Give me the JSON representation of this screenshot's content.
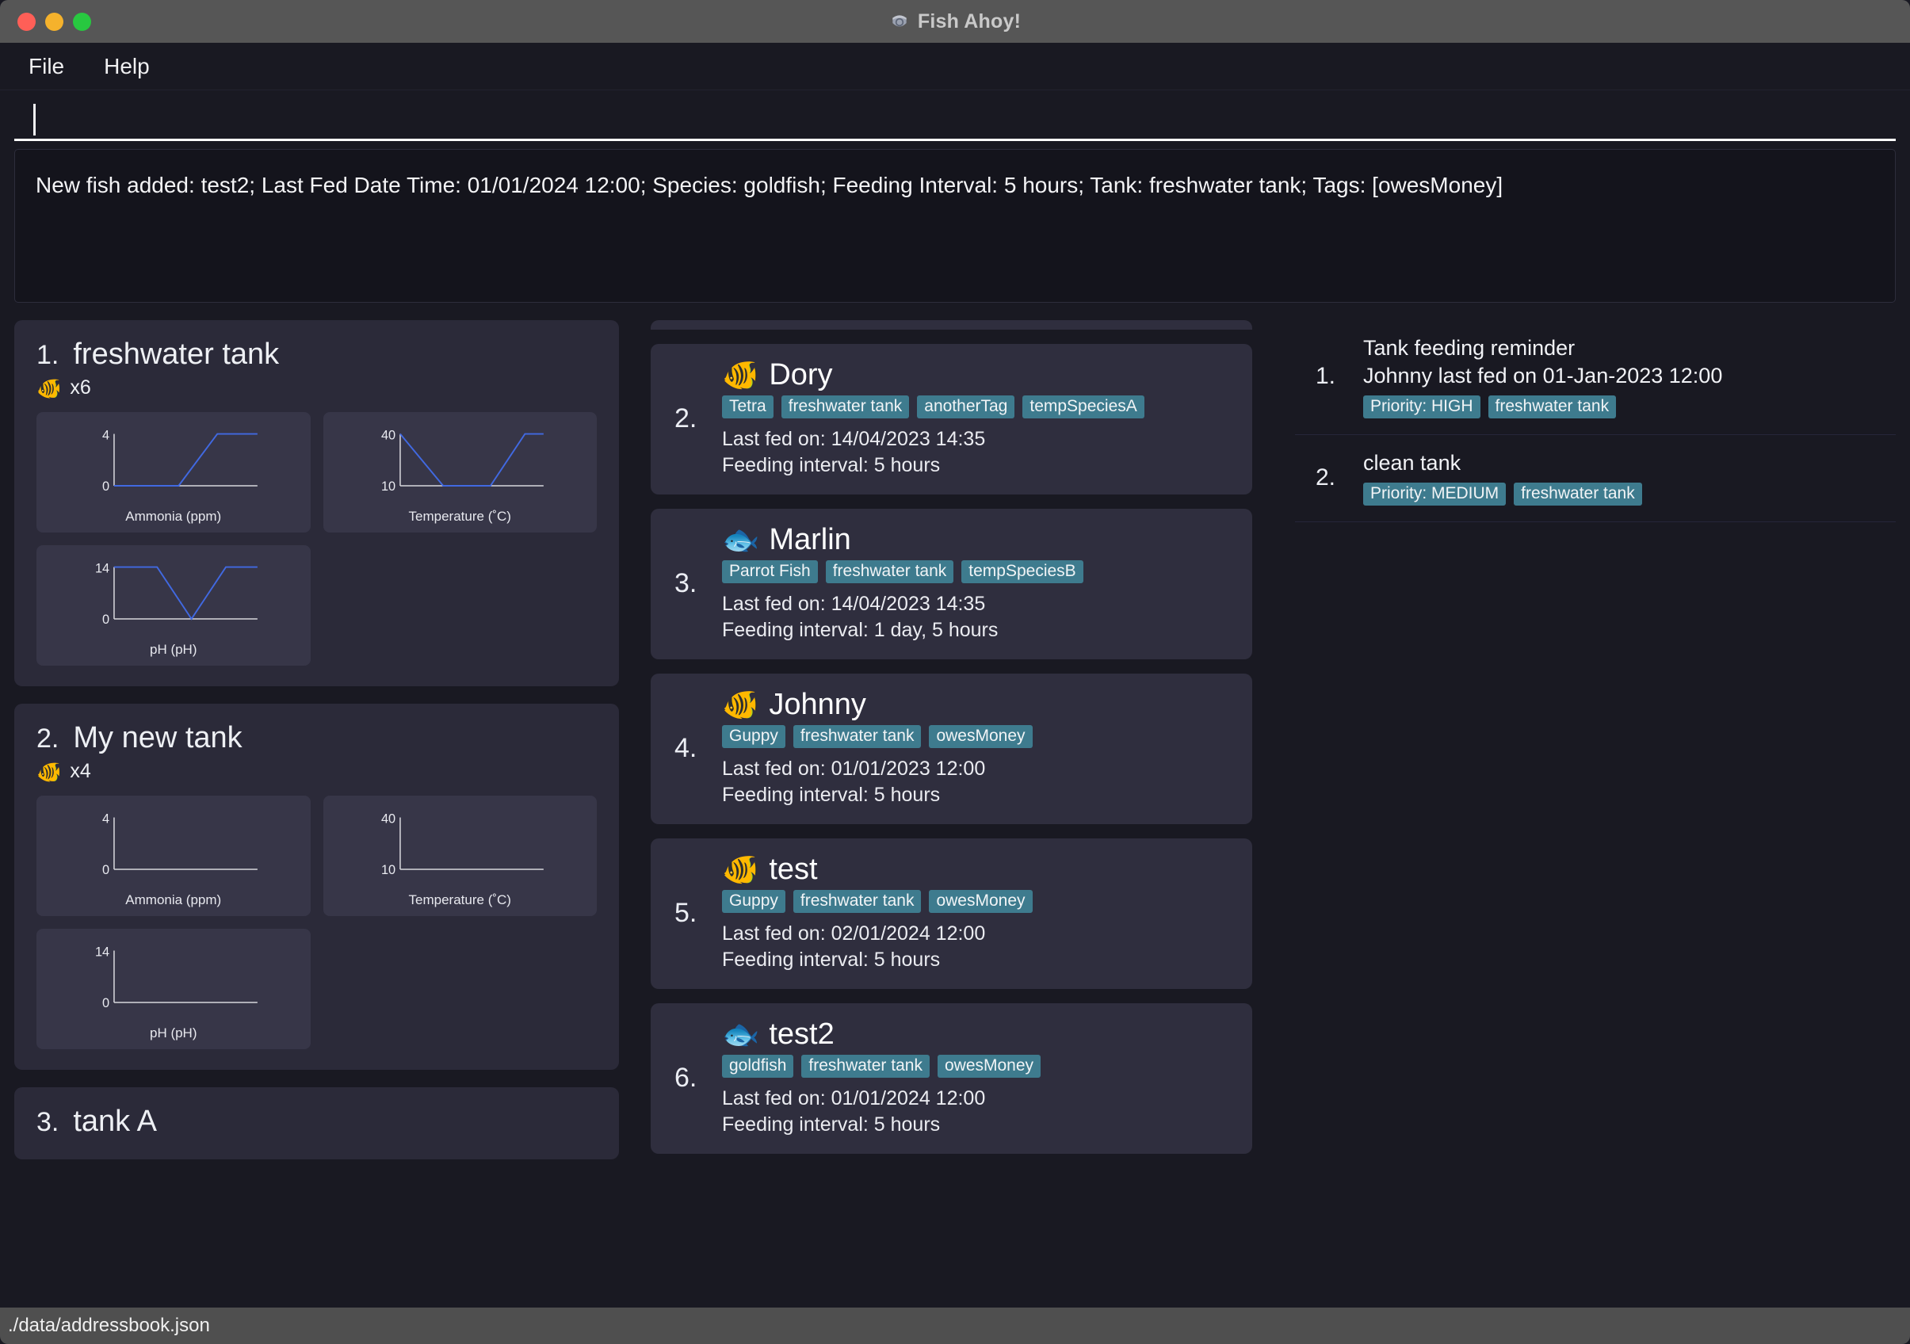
{
  "window": {
    "title": "Fish Ahoy!",
    "app_icon": "fish-bowl-icon",
    "traffic_lights": [
      "close",
      "minimize",
      "maximize"
    ]
  },
  "menubar": {
    "items": [
      {
        "label": "File",
        "name": "menu-file"
      },
      {
        "label": "Help",
        "name": "menu-help"
      }
    ]
  },
  "command": {
    "value": "",
    "placeholder": ""
  },
  "result": {
    "text": "New fish added: test2; Last Fed Date Time: 01/01/2024 12:00; Species: goldfish; Feeding Interval: 5 hours; Tank: freshwater tank; Tags: [owesMoney]"
  },
  "tanks": [
    {
      "index": "1.",
      "name": "freshwater tank",
      "fish_icon": "tropical-fish-icon",
      "count_label": "x6",
      "charts": [
        {
          "label": "Ammonia (ppm)",
          "y_top": "4",
          "y_bottom": "0",
          "points": [
            [
              0,
              0
            ],
            [
              0.45,
              0
            ],
            [
              0.72,
              1
            ],
            [
              1,
              1
            ]
          ]
        },
        {
          "label": "Temperature (˚C)",
          "y_top": "40",
          "y_bottom": "10",
          "points": [
            [
              0,
              1
            ],
            [
              0.3,
              0
            ],
            [
              0.63,
              0
            ],
            [
              0.87,
              1
            ],
            [
              1,
              1
            ]
          ]
        },
        {
          "label": "pH (pH)",
          "y_top": "14",
          "y_bottom": "0",
          "points": [
            [
              0,
              1
            ],
            [
              0.3,
              1
            ],
            [
              0.54,
              0
            ],
            [
              0.78,
              1
            ],
            [
              1,
              1
            ]
          ]
        }
      ]
    },
    {
      "index": "2.",
      "name": "My new tank",
      "fish_icon": "tropical-fish-icon",
      "count_label": "x4",
      "charts": [
        {
          "label": "Ammonia (ppm)",
          "y_top": "4",
          "y_bottom": "0",
          "points": []
        },
        {
          "label": "Temperature (˚C)",
          "y_top": "40",
          "y_bottom": "10",
          "points": []
        },
        {
          "label": "pH (pH)",
          "y_top": "14",
          "y_bottom": "0",
          "points": []
        }
      ]
    },
    {
      "index": "3.",
      "name": "tank A",
      "fish_icon": "tropical-fish-icon",
      "count_label": "",
      "charts": []
    }
  ],
  "fish": [
    {
      "number": "2.",
      "name": "Dory",
      "avatar": "tropical-fish-icon",
      "tags": [
        "Tetra",
        "freshwater tank",
        "anotherTag",
        "tempSpeciesA"
      ],
      "last_fed": "Last fed on: 14/04/2023 14:35",
      "interval": "Feeding interval: 5 hours"
    },
    {
      "number": "3.",
      "name": "Marlin",
      "avatar": "parrot-fish-icon",
      "tags": [
        "Parrot Fish",
        "freshwater tank",
        "tempSpeciesB"
      ],
      "last_fed": "Last fed on: 14/04/2023 14:35",
      "interval": "Feeding interval: 1 day, 5 hours"
    },
    {
      "number": "4.",
      "name": "Johnny",
      "avatar": "guppy-icon",
      "tags": [
        "Guppy",
        "freshwater tank",
        "owesMoney"
      ],
      "last_fed": "Last fed on: 01/01/2023 12:00",
      "interval": "Feeding interval: 5 hours"
    },
    {
      "number": "5.",
      "name": "test",
      "avatar": "guppy-icon",
      "tags": [
        "Guppy",
        "freshwater tank",
        "owesMoney"
      ],
      "last_fed": "Last fed on: 02/01/2024 12:00",
      "interval": "Feeding interval: 5 hours"
    },
    {
      "number": "6.",
      "name": "test2",
      "avatar": "goldfish-icon",
      "tags": [
        "goldfish",
        "freshwater tank",
        "owesMoney"
      ],
      "last_fed": "Last fed on: 01/01/2024 12:00",
      "interval": "Feeding interval: 5 hours"
    }
  ],
  "tasks": [
    {
      "number": "1.",
      "title": "Tank feeding reminder",
      "subtitle": "Johnny last fed on 01-Jan-2023 12:00",
      "tags": [
        "Priority: HIGH",
        "freshwater tank"
      ]
    },
    {
      "number": "2.",
      "title": "clean tank",
      "subtitle": "",
      "tags": [
        "Priority: MEDIUM",
        "freshwater tank"
      ]
    }
  ],
  "statusbar": {
    "path": "./data/addressbook.json"
  },
  "colors": {
    "background": "#191922",
    "titlebar": "#565656",
    "card": "#2f2e3e",
    "tank_panel": "#2b2a39",
    "chart_panel": "#373648",
    "tag": "#3e7b8e",
    "chart_line": "#4169e1",
    "axis": "#d7d7dc",
    "text": "#f1f2f6"
  }
}
